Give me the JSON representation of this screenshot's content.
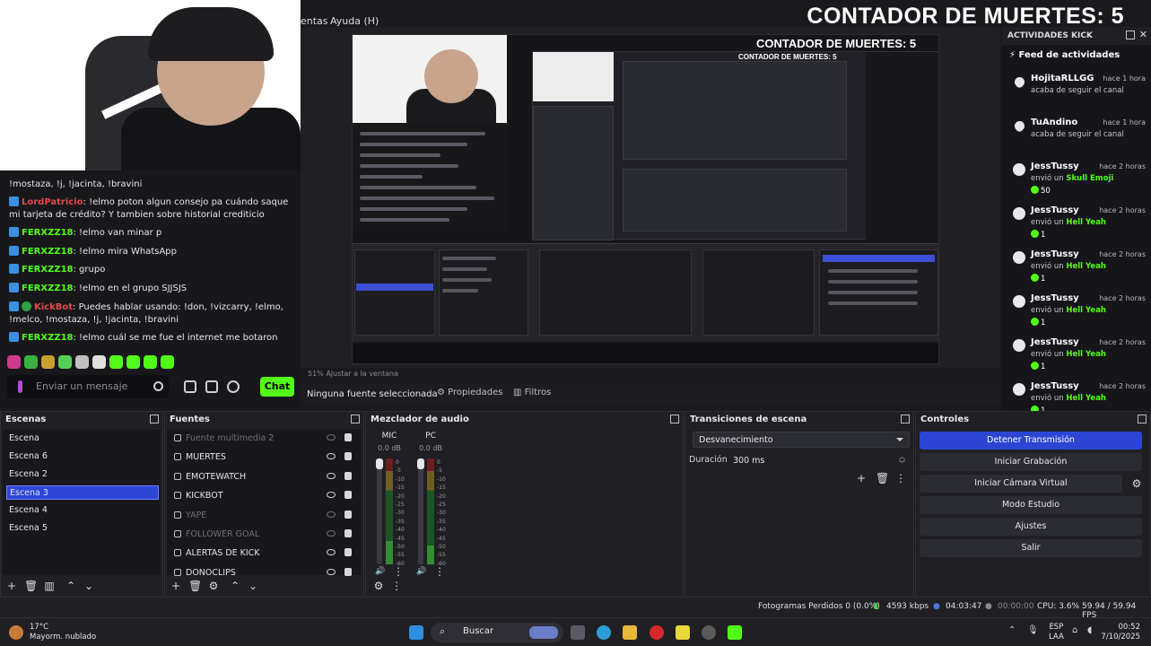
{
  "overlay": {
    "death_counter": "CONTADOR DE MUERTES: 5",
    "preview_death_counter": "CONTADOR DE MUERTES: 5",
    "nested_death_counter": "CONTADOR DE MUERTES: 5"
  },
  "obs_menu": {
    "partial_item": "entas",
    "help": "Ayuda (H)"
  },
  "chat": {
    "messages": [
      {
        "user": "",
        "text": "!mostaza, !j, !jacinta, !bravini"
      },
      {
        "user": "LordPatricio",
        "text": ": !elmo poton algun consejo pa cuándo saque mi tarjeta de crédito? Y tambien sobre historial crediticio"
      },
      {
        "user": "FERXZZ18",
        "text": ": !elmo van minar p"
      },
      {
        "user": "FERXZZ18",
        "text": ": !elmo mira WhatsApp"
      },
      {
        "user": "FERXZZ18",
        "text": ": grupo"
      },
      {
        "user": "FERXZZ18",
        "text": ": !elmo en el grupo SJJSJS"
      },
      {
        "user": "KickBot",
        "text": ": Puedes hablar usando: !don, !vizcarry, !elmo, !melco, !mostaza, !j, !jacinta, !bravini"
      },
      {
        "user": "FERXZZ18",
        "text": ": !elmo cuál se me fue el internet me botaron"
      }
    ],
    "input_placeholder": "Enviar un mensaje",
    "send_label": "Chat",
    "brand_color": "#53fc18"
  },
  "preview": {
    "zoom_status": "51%   Ajustar a la ventana",
    "no_source": "Ninguna fuente seleccionada",
    "properties": "Propiedades",
    "filters": "Filtros"
  },
  "feed": {
    "header": "ACTIVIDADES KICK",
    "title": "Feed de actividades",
    "items": [
      {
        "icon": "heart-icon",
        "name": "HojitaRLLGG",
        "time": "hace 1 hora",
        "desc": "acaba de seguir el canal",
        "gift": "",
        "amount": ""
      },
      {
        "icon": "heart-icon",
        "name": "TuAndino",
        "time": "hace 1 hora",
        "desc": "acaba de seguir el canal",
        "gift": "",
        "amount": ""
      },
      {
        "icon": "kick-icon",
        "name": "JessTussy",
        "time": "hace 2 horas",
        "desc": "envió un ",
        "gift": "Skull Emoji",
        "amount": "50"
      },
      {
        "icon": "kick-icon",
        "name": "JessTussy",
        "time": "hace 2 horas",
        "desc": "envió un ",
        "gift": "Hell Yeah",
        "amount": "1"
      },
      {
        "icon": "kick-icon",
        "name": "JessTussy",
        "time": "hace 2 horas",
        "desc": "envió un ",
        "gift": "Hell Yeah",
        "amount": "1"
      },
      {
        "icon": "kick-icon",
        "name": "JessTussy",
        "time": "hace 2 horas",
        "desc": "envió un ",
        "gift": "Hell Yeah",
        "amount": "1"
      },
      {
        "icon": "kick-icon",
        "name": "JessTussy",
        "time": "hace 2 horas",
        "desc": "envió un ",
        "gift": "Hell Yeah",
        "amount": "1"
      },
      {
        "icon": "kick-icon",
        "name": "JessTussy",
        "time": "hace 2 horas",
        "desc": "envió un ",
        "gift": "Hell Yeah",
        "amount": "1"
      }
    ]
  },
  "scenes": {
    "title": "Escenas",
    "items": [
      "Escena",
      "Escena 6",
      "Escena 2",
      "Escena 3",
      "Escena 4",
      "Escena 5"
    ],
    "active": "Escena 3"
  },
  "sources": {
    "title": "Fuentes",
    "items": [
      {
        "label": "Fuente multimedia 2",
        "visible": false
      },
      {
        "label": "MUERTES",
        "visible": true
      },
      {
        "label": "EMOTEWATCH",
        "visible": true
      },
      {
        "label": "KICKBOT",
        "visible": true
      },
      {
        "label": "YAPE",
        "visible": false
      },
      {
        "label": "FOLLOWER GOAL",
        "visible": false
      },
      {
        "label": "ALERTAS DE KICK",
        "visible": true
      },
      {
        "label": "DONOCLIPS",
        "visible": true
      }
    ]
  },
  "mixer": {
    "title": "Mezclador de audio",
    "channels": [
      {
        "name": "MIC",
        "db": "0.0 dB",
        "level": 0.22
      },
      {
        "name": "PC",
        "db": "0.0 dB",
        "level": 0.18
      }
    ],
    "ticks": [
      "0",
      "-5",
      "-10",
      "-15",
      "-20",
      "-25",
      "-30",
      "-35",
      "-40",
      "-45",
      "-50",
      "-55",
      "-60"
    ]
  },
  "transitions": {
    "title": "Transiciones de escena",
    "selected": "Desvanecimiento",
    "duration_label": "Duración",
    "duration_value": "300 ms"
  },
  "controls": {
    "title": "Controles",
    "buttons": [
      "Detener Transmisión",
      "Iniciar Grabación",
      "Iniciar Cámara Virtual",
      "Modo Estudio",
      "Ajustes",
      "Salir"
    ]
  },
  "status": {
    "dropped": "Fotogramas Perdidos 0 (0.0%)",
    "bitrate": "4593 kbps",
    "live_time": "04:03:47",
    "rec_time": "00:00:00",
    "cpu": "CPU: 3.6%",
    "fps": "59.94 / 59.94 FPS"
  },
  "taskbar": {
    "temp": "17°C",
    "weather": "Mayorm. nublado",
    "search": "Buscar",
    "lang1": "ESP",
    "lang2": "LAA",
    "time": "00:52",
    "date": "7/10/2025"
  }
}
